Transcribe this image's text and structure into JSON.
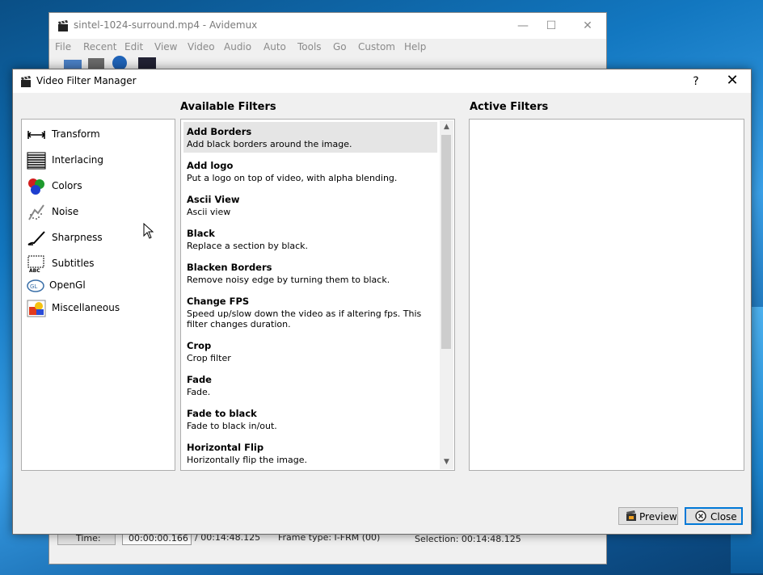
{
  "main_window": {
    "title": "sintel-1024-surround.mp4 - Avidemux",
    "menu": [
      "File",
      "Recent",
      "Edit",
      "View",
      "Video",
      "Audio",
      "Auto",
      "Tools",
      "Go",
      "Custom",
      "Help"
    ],
    "bottom": {
      "time_button": "Time:",
      "time_value": "00:00:00.166",
      "total_time": "/ 00:14:48.125",
      "frame_type": "Frame type:  I-FRM (00)",
      "selection": "Selection: 00:14:48.125"
    }
  },
  "dialog": {
    "title": "Video Filter Manager",
    "help_glyph": "?",
    "close_glyph": "✕",
    "available_label": "Available Filters",
    "active_label": "Active Filters",
    "categories": [
      {
        "label": "Transform",
        "icon": "transform-icon"
      },
      {
        "label": "Interlacing",
        "icon": "interlacing-icon"
      },
      {
        "label": "Colors",
        "icon": "colors-icon"
      },
      {
        "label": "Noise",
        "icon": "noise-icon"
      },
      {
        "label": "Sharpness",
        "icon": "sharpness-icon"
      },
      {
        "label": "Subtitles",
        "icon": "subtitles-icon"
      },
      {
        "label": "OpenGl",
        "icon": "opengl-icon"
      },
      {
        "label": "Miscellaneous",
        "icon": "miscellaneous-icon"
      }
    ],
    "filters": [
      {
        "name": "Add Borders",
        "desc": "Add black borders around the image.",
        "selected": true
      },
      {
        "name": "Add logo",
        "desc": "Put a logo on top of video, with alpha blending."
      },
      {
        "name": "Ascii View",
        "desc": "Ascii view"
      },
      {
        "name": "Black",
        "desc": "Replace a section by black."
      },
      {
        "name": "Blacken Borders",
        "desc": "Remove noisy edge by turning them to black."
      },
      {
        "name": "Change FPS",
        "desc": "Speed up/slow down the video as if altering fps. This filter changes duration."
      },
      {
        "name": "Crop",
        "desc": "Crop filter"
      },
      {
        "name": "Fade",
        "desc": "Fade."
      },
      {
        "name": "Fade to black",
        "desc": "Fade to black in/out."
      },
      {
        "name": "Horizontal Flip",
        "desc": "Horizontally flip the image."
      }
    ],
    "buttons": {
      "preview": "Preview",
      "close": "Close"
    }
  }
}
